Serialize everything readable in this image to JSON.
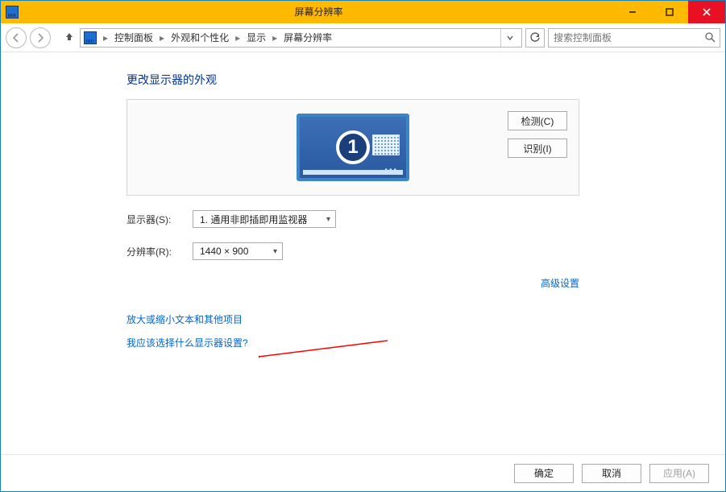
{
  "titlebar": {
    "title": "屏幕分辨率"
  },
  "nav": {
    "crumbs": [
      "控制面板",
      "外观和个性化",
      "显示",
      "屏幕分辨率"
    ],
    "search_placeholder": "搜索控制面板"
  },
  "page": {
    "heading": "更改显示器的外观",
    "detect": "检测(C)",
    "identify": "识别(I)",
    "display_label": "显示器(S):",
    "display_value": "1. 通用非即插即用监视器",
    "resolution_label": "分辨率(R):",
    "resolution_value": "1440 × 900",
    "advanced": "高级设置",
    "link_textsize": "放大或缩小文本和其他项目",
    "link_which": "我应该选择什么显示器设置?",
    "monitor_number": "1",
    "ok": "确定",
    "cancel": "取消",
    "apply": "应用(A)"
  }
}
